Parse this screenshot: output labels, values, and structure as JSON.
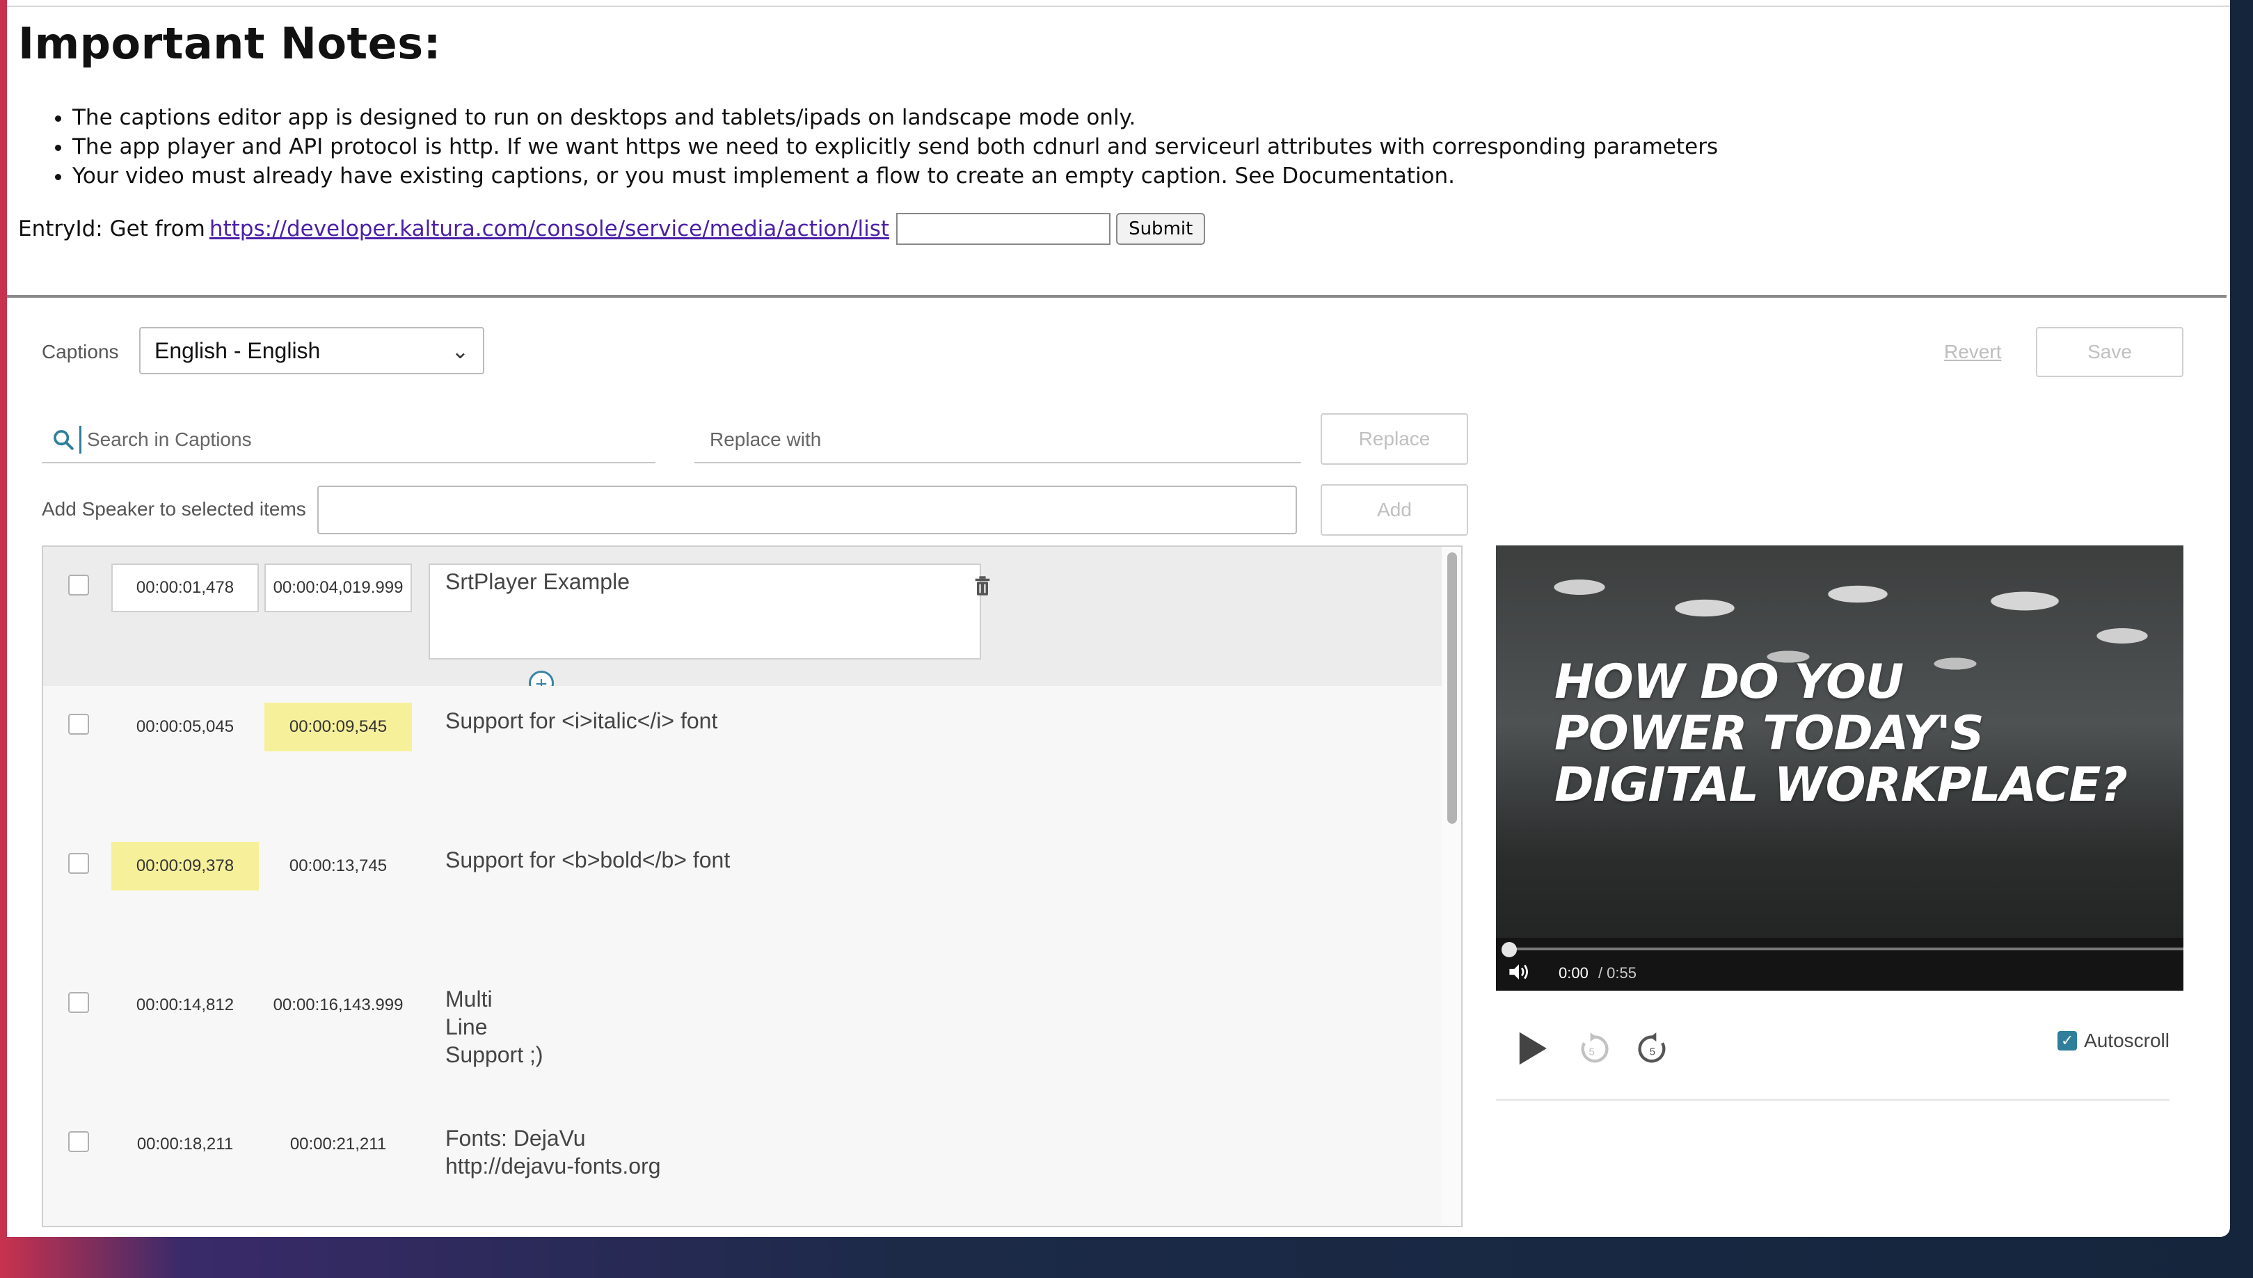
{
  "header": {
    "title": "Important Notes:",
    "notes": [
      "The captions editor app is designed to run on desktops and tablets/ipads on landscape mode only.",
      "The app player and API protocol is http. If we want https we need to explicitly send both cdnurl and serviceurl attributes with corresponding parameters",
      "Your video must already have existing captions, or you must implement a flow to create an empty caption. See Documentation."
    ],
    "entry_label": "EntryId: Get from",
    "entry_link": "https://developer.kaltura.com/console/service/media/action/list",
    "entry_input_value": "",
    "submit_label": "Submit"
  },
  "editor": {
    "captions_label": "Captions",
    "language_selected": "English - English",
    "revert_label": "Revert",
    "save_label": "Save",
    "search_placeholder": "Search in Captions",
    "replace_placeholder": "Replace with",
    "replace_button": "Replace",
    "speaker_label": "Add Speaker to selected items",
    "speaker_value": "",
    "add_button": "Add",
    "rows": [
      {
        "start": "00:00:01,478",
        "end": "00:00:04,019.999",
        "lines": [
          "SrtPlayer Example"
        ]
      },
      {
        "start": "00:00:05,045",
        "end": "00:00:09,545",
        "lines": [
          "Support for <i>italic</i> font"
        ]
      },
      {
        "start": "00:00:09,378",
        "end": "00:00:13,745",
        "lines": [
          "Support for <b>bold</b> font"
        ]
      },
      {
        "start": "00:00:14,812",
        "end": "00:00:16,143.999",
        "lines": [
          "Multi",
          "Line",
          "Support ;)"
        ]
      },
      {
        "start": "00:00:18,211",
        "end": "00:00:21,211",
        "lines": [
          "Fonts: DejaVu",
          "http://dejavu-fonts.org"
        ]
      }
    ]
  },
  "player": {
    "overlay_lines": [
      "HOW DO YOU",
      "POWER TODAY'S",
      "DIGITAL WORKPLACE?"
    ],
    "current_time": "0:00",
    "duration": "/ 0:55",
    "progress_fraction": 0,
    "autoscroll_label": "Autoscroll",
    "autoscroll_checked": true
  },
  "colors": {
    "highlight": "#f6f09a",
    "accent": "#2e7e9c",
    "link": "#4b1fa8"
  }
}
